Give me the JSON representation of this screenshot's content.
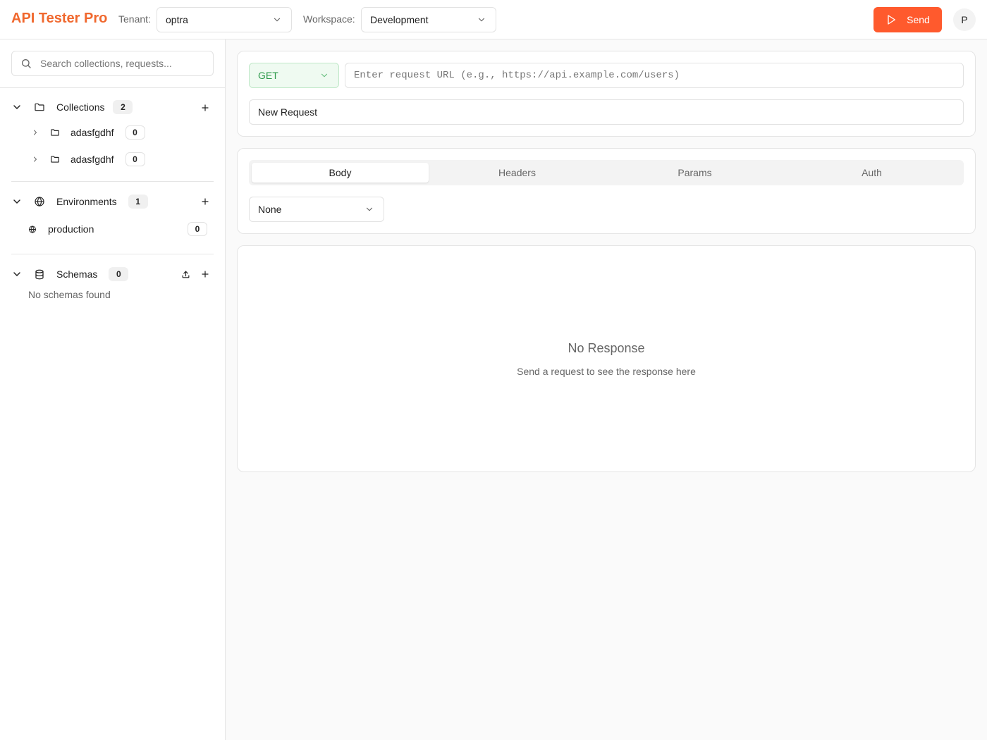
{
  "header": {
    "brand": "API Tester Pro",
    "tenant_label": "Tenant:",
    "tenant_value": "optra",
    "workspace_label": "Workspace:",
    "workspace_value": "Development",
    "send_label": "Send",
    "avatar_initial": "P",
    "accent_color": "#ff5a2d"
  },
  "sidebar": {
    "search_placeholder": "Search collections, requests...",
    "collections": {
      "label": "Collections",
      "count": "2",
      "items": [
        {
          "name": "adasfgdhf",
          "count": "0"
        },
        {
          "name": "adasfgdhf",
          "count": "0"
        }
      ]
    },
    "environments": {
      "label": "Environments",
      "count": "1",
      "items": [
        {
          "name": "production",
          "count": "0"
        }
      ]
    },
    "schemas": {
      "label": "Schemas",
      "count": "0",
      "empty_text": "No schemas found"
    }
  },
  "request": {
    "method": "GET",
    "url_placeholder": "Enter request URL (e.g., https://api.example.com/users)",
    "name": "New Request"
  },
  "tabs": {
    "items": [
      "Body",
      "Headers",
      "Params",
      "Auth"
    ],
    "active": "Body",
    "body_type": "None"
  },
  "response": {
    "title": "No Response",
    "subtitle": "Send a request to see the response here"
  }
}
